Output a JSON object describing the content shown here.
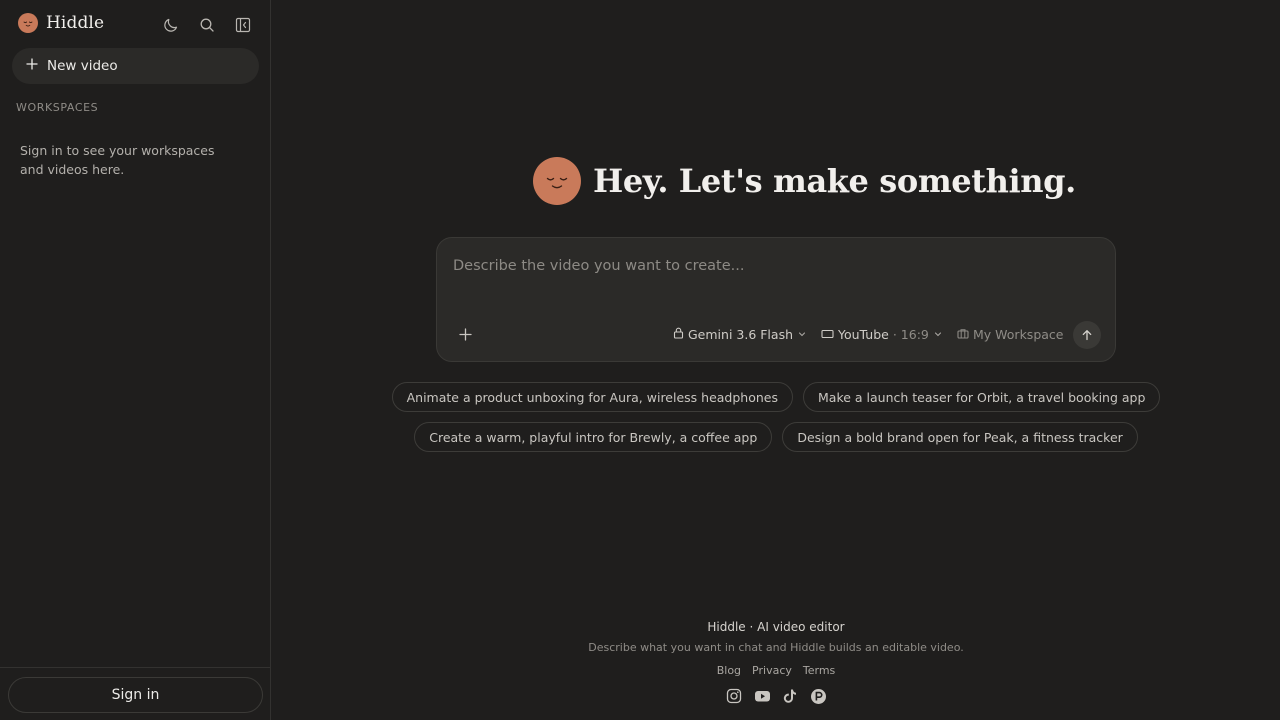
{
  "app": {
    "name": "Hiddle",
    "logo_icon": "smiley-face-icon",
    "accent_color": "#c97a5a"
  },
  "sidebar": {
    "icons": [
      "moon-icon",
      "search-icon",
      "sidebar-collapse-icon"
    ],
    "new_video_label": "New video",
    "workspaces_title": "WORKSPACES",
    "workspaces_empty": "Sign in to see your workspaces and videos here.",
    "sign_in_label": "Sign in"
  },
  "main": {
    "hero_title": "Hey. Let's make something.",
    "composer": {
      "placeholder": "Describe the video you want to create...",
      "value": "",
      "model": "Gemini 3.6 Flash",
      "format": "YouTube",
      "ratio": "· 16:9",
      "workspace": "My Workspace"
    },
    "suggestions": [
      "Animate a product unboxing for Aura, wireless headphones",
      "Make a launch teaser for Orbit, a travel booking app",
      "Create a warm, playful intro for Brewly, a coffee app",
      "Design a bold brand open for Peak, a fitness tracker"
    ]
  },
  "footer": {
    "title": "Hiddle · AI video editor",
    "subtitle": "Describe what you want in chat and Hiddle builds an editable video.",
    "links": [
      "Blog",
      "Privacy",
      "Terms"
    ],
    "socials": [
      "instagram-icon",
      "youtube-icon",
      "tiktok-icon",
      "producthunt-icon"
    ]
  }
}
